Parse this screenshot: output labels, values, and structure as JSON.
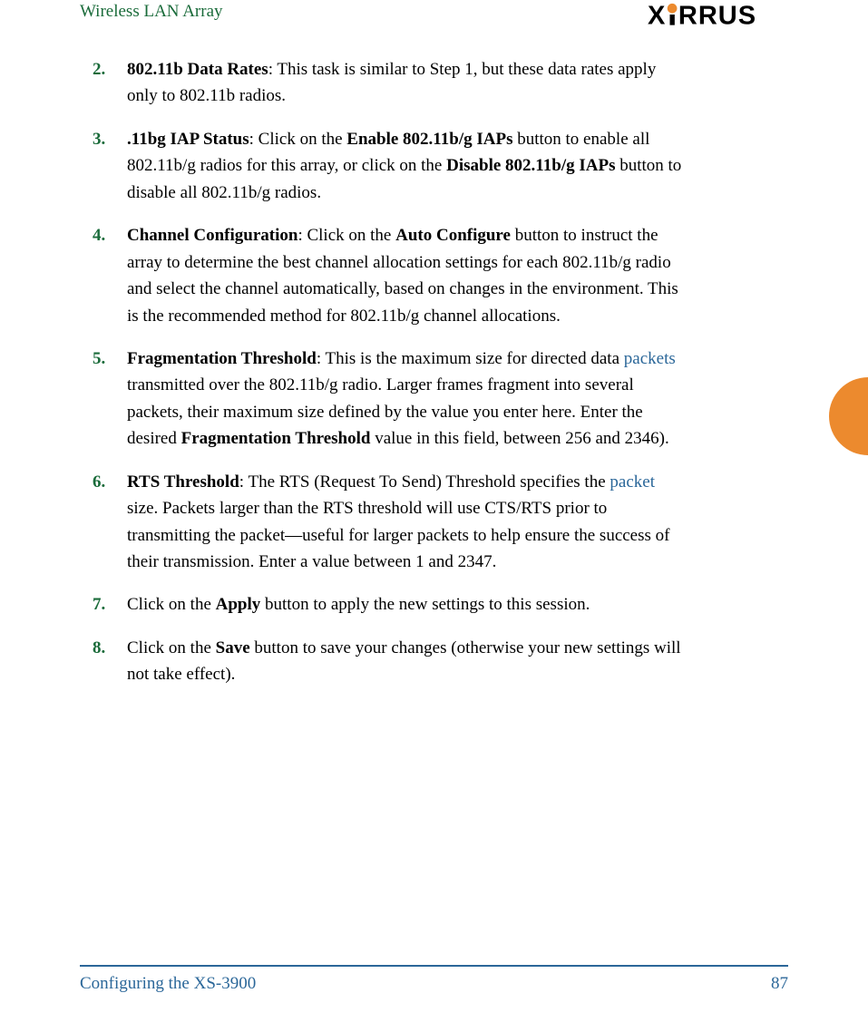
{
  "header": {
    "title": "Wireless LAN Array",
    "logo_text": "XIRRUS"
  },
  "items": [
    {
      "num": "2.",
      "title": "802.11b Data Rates",
      "text_parts": [
        ": This task is similar to Step 1, but these data rates apply only to 802.11b radios."
      ]
    },
    {
      "num": "3.",
      "title": ".11bg IAP Status",
      "text_parts": [
        ": Click on the ",
        {
          "bold": "Enable 802.11b/g IAPs"
        },
        " button to enable all 802.11b/g radios for this array, or click on the ",
        {
          "bold": "Disable 802.11b/g IAPs"
        },
        " button to disable all 802.11b/g radios."
      ]
    },
    {
      "num": "4.",
      "title": "Channel Configuration",
      "text_parts": [
        ": Click on the ",
        {
          "bold": "Auto Configure"
        },
        " button to instruct the array to determine the best channel allocation settings for each 802.11b/g radio and select the channel automatically, based on changes in the environment. This is the recommended method for 802.11b/g channel allocations."
      ]
    },
    {
      "num": "5.",
      "title": "Fragmentation Threshold",
      "text_parts": [
        ": This is the maximum size for directed data ",
        {
          "link": "packets"
        },
        " transmitted over the 802.11b/g radio. Larger frames fragment into several packets, their maximum size defined by the value you enter here. Enter the desired ",
        {
          "bold": "Fragmentation Threshold"
        },
        " value in this field, between 256 and 2346)."
      ]
    },
    {
      "num": "6.",
      "title": "RTS Threshold",
      "text_parts": [
        ": The RTS (Request To Send) Threshold specifies the ",
        {
          "link": "packet"
        },
        " size. Packets larger than the RTS threshold will use CTS/RTS prior to transmitting the packet—useful for larger packets to help ensure the success of their transmission. Enter a value between 1 and 2347."
      ]
    },
    {
      "num": "7.",
      "title": "",
      "text_parts": [
        "Click on the ",
        {
          "bold": "Apply"
        },
        " button to apply the new settings to this session."
      ]
    },
    {
      "num": "8.",
      "title": "",
      "text_parts": [
        "Click on the ",
        {
          "bold": "Save"
        },
        " button to save your changes (otherwise your new settings will not take effect)."
      ]
    }
  ],
  "footer": {
    "section": "Configuring the XS-3900",
    "page": "87"
  }
}
